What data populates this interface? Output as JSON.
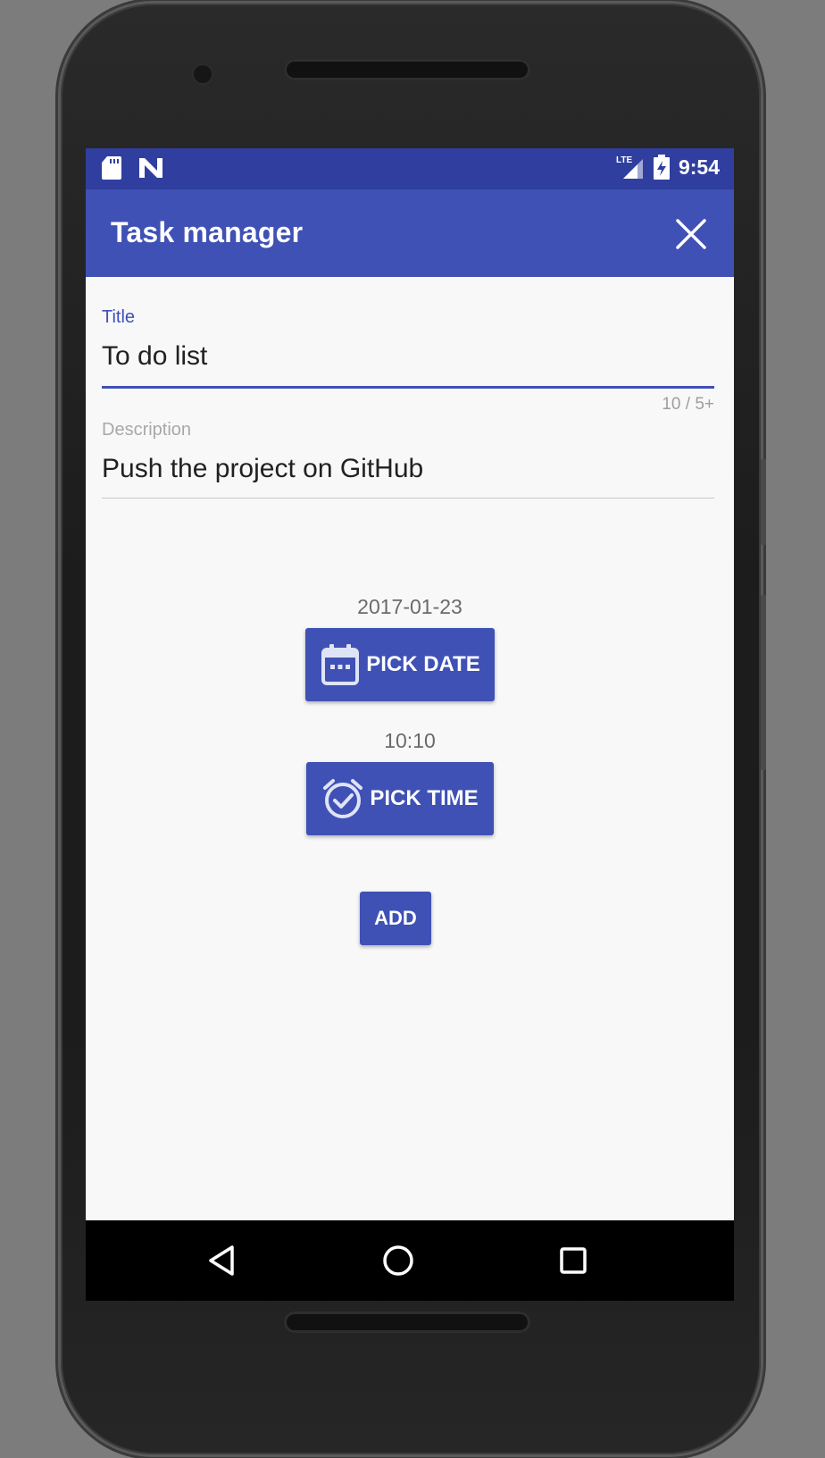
{
  "status_bar": {
    "time": "9:54",
    "left_icons": [
      "sd-card-icon",
      "n-icon"
    ],
    "right_icons": [
      "lte-signal-icon",
      "battery-charging-icon"
    ]
  },
  "app_bar": {
    "title": "Task manager",
    "close_icon": "close-icon"
  },
  "form": {
    "title_label": "Title",
    "title_value": "To do list",
    "title_counter": "10 / 5+",
    "description_label": "Description",
    "description_value": "Push the project on GitHub"
  },
  "date": {
    "value": "2017-01-23",
    "button_label": "PICK DATE",
    "icon": "calendar-icon"
  },
  "time": {
    "value": "10:10",
    "button_label": "PICK TIME",
    "icon": "alarm-check-icon"
  },
  "actions": {
    "add_label": "ADD"
  },
  "nav_bar": {
    "icons": [
      "back-icon",
      "home-icon",
      "recents-icon"
    ]
  },
  "colors": {
    "primary": "#3f51b5",
    "primary_dark": "#303f9f",
    "background": "#f8f8f9"
  }
}
